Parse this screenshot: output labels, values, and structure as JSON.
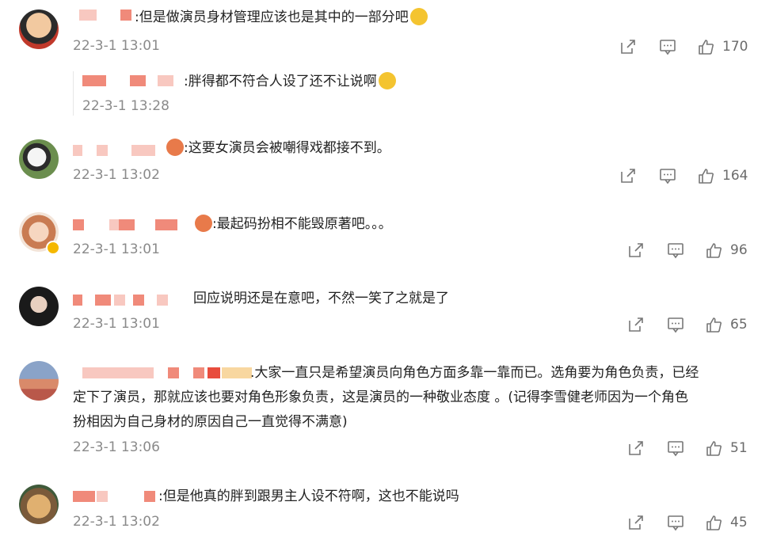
{
  "comments": [
    {
      "text": ":但是做演员身材管理应该也是其中的一部分吧",
      "time": "22-3-1 13:01",
      "likes": "170",
      "reply": {
        "text": ":胖得都不符合人设了还不让说啊",
        "time": "22-3-1 13:28"
      }
    },
    {
      "text": ":这要女演员会被嘲得戏都接不到。",
      "time": "22-3-1 13:02",
      "likes": "164"
    },
    {
      "text": ":最起码扮相不能毁原著吧。。。",
      "time": "22-3-1 13:01",
      "likes": "96"
    },
    {
      "text": "回应说明还是在意吧，不然一笑了之就是了",
      "time": "22-3-1 13:01",
      "likes": "65"
    },
    {
      "text_line1": ".大家一直只是希望演员向角色方面多靠一靠而已。选角要为角色负责，已经",
      "text_line2": "定下了演员，那就应该也要对角色形象负责，这是演员的一种敬业态度 。(记得李雪健老师因为一个角色",
      "text_line3": "扮相因为自己身材的原因自己一直觉得不满意)",
      "time": "22-3-1 13:06",
      "likes": "51"
    },
    {
      "text": ":但是他真的胖到跟男主人设不符啊，这也不能说吗",
      "time": "22-3-1 13:02",
      "likes": "45"
    }
  ],
  "icons": {
    "share": "share-icon",
    "comment": "comment-icon",
    "like": "thumbs-up-icon"
  },
  "colors": {
    "redacted": "#f08a7a",
    "redacted_light": "#f8c8c0",
    "time": "#8a8a8a",
    "count": "#6b6b6b"
  }
}
